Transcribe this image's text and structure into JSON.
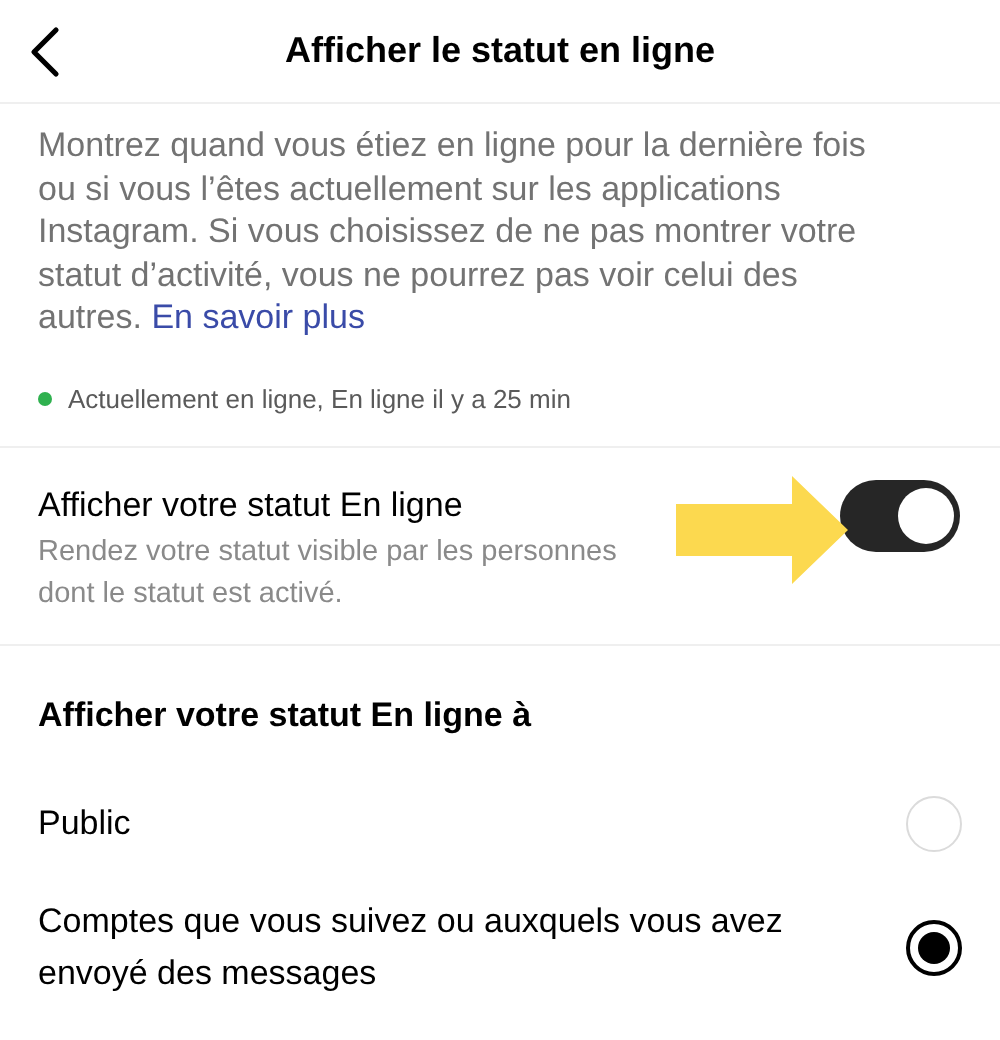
{
  "header": {
    "title": "Afficher le statut en ligne"
  },
  "description": {
    "text": "Montrez quand vous étiez en ligne pour la dernière fois ou si vous l’êtes actuellement sur les applications Instagram. Si vous choisissez de ne pas montrer votre statut d’activité, vous ne pourrez pas voir celui des autres.",
    "link": "En savoir plus"
  },
  "status_line": {
    "text": "Actuellement en ligne, En ligne il y a 25 min"
  },
  "toggle_row": {
    "title": "Afficher votre statut En ligne",
    "description": "Rendez votre statut visible par les personnes dont le statut est activé.",
    "on": true
  },
  "audience": {
    "heading": "Afficher votre statut En ligne à",
    "options": [
      {
        "label": "Public",
        "selected": false
      },
      {
        "label": "Comptes que vous suivez ou auxquels vous avez envoyé des messages",
        "selected": true
      }
    ]
  }
}
